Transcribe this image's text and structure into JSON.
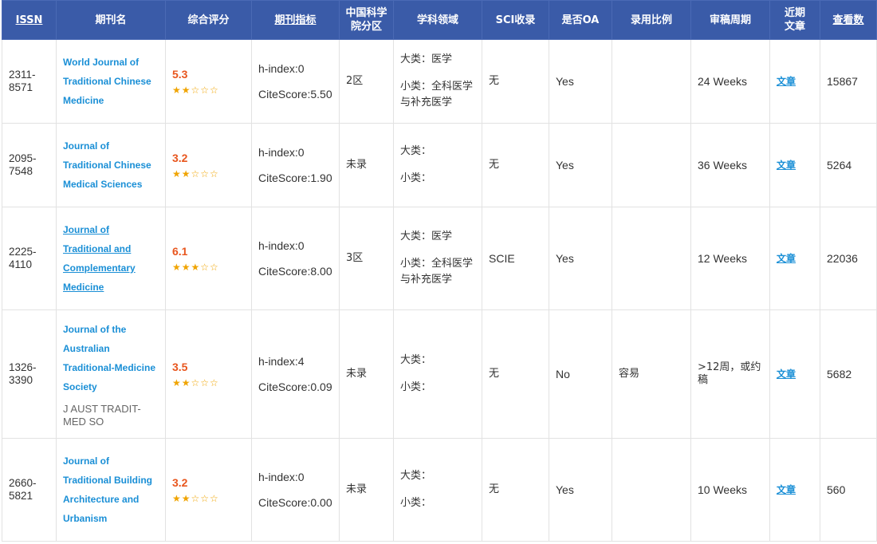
{
  "headers": {
    "issn": "ISSN",
    "name": "期刊名",
    "score": "综合评分",
    "metrics": "期刊指标",
    "cas_line1": "中国科学",
    "cas_line2": "院分区",
    "field": "学科领域",
    "sci": "SCI收录",
    "oa": "是否OA",
    "ratio": "录用比例",
    "review": "审稿周期",
    "recent_line1": "近期",
    "recent_line2": "文章",
    "views": "查看数"
  },
  "rows": [
    {
      "issn_a": "2311-",
      "issn_b": "8571",
      "name_lines": [
        "World Journal of",
        "Traditional Chinese",
        "Medicine"
      ],
      "abbr": "",
      "score": "5.3",
      "stars": "★★☆☆☆",
      "rating_stars": 2.5,
      "hindex": "h-index:0",
      "citescore": "CiteScore:5.50",
      "cas": "2区",
      "major": "大类：医学",
      "minor": "小类：全科医学与补充医学",
      "sci": "无",
      "oa": "Yes",
      "ratio": "",
      "review": "24 Weeks",
      "article": "文章",
      "views": "15867"
    },
    {
      "issn_a": "2095-",
      "issn_b": "7548",
      "name_lines": [
        "Journal of",
        "Traditional Chinese",
        "Medical Sciences"
      ],
      "abbr": "",
      "score": "3.2",
      "stars": "★★☆☆☆",
      "rating_stars": 1.5,
      "hindex": "h-index:0",
      "citescore": "CiteScore:1.90",
      "cas": "未录",
      "major": "大类：",
      "minor": "小类：",
      "sci": "无",
      "oa": "Yes",
      "ratio": "",
      "review": "36 Weeks",
      "article": "文章",
      "views": "5264"
    },
    {
      "issn_a": "2225-",
      "issn_b": "4110",
      "name_lines": [
        "Journal of",
        "Traditional and",
        "Complementary",
        "Medicine"
      ],
      "abbr": "",
      "score": "6.1",
      "stars": "★★★☆☆",
      "rating_stars": 3,
      "hindex": "h-index:0",
      "citescore": "CiteScore:8.00",
      "cas": "3区",
      "major": "大类：医学",
      "minor": "小类：全科医学与补充医学",
      "sci": "SCIE",
      "oa": "Yes",
      "ratio": "",
      "review": "12 Weeks",
      "article": "文章",
      "views": "22036"
    },
    {
      "issn_a": "1326-",
      "issn_b": "3390",
      "name_lines": [
        "Journal of the",
        "Australian",
        "Traditional-Medicine",
        "Society"
      ],
      "abbr": "J AUST TRADIT-MED SO",
      "score": "3.5",
      "stars": "★★☆☆☆",
      "rating_stars": 1.5,
      "hindex": "h-index:4",
      "citescore": "CiteScore:0.09",
      "cas": "未录",
      "major": "大类：",
      "minor": "小类：",
      "sci": "无",
      "oa": "No",
      "ratio": "容易",
      "review": ">12周，或约稿",
      "article": "文章",
      "views": "5682"
    },
    {
      "issn_a": "2660-",
      "issn_b": "5821",
      "name_lines": [
        "Journal of",
        "Traditional Building",
        "Architecture and",
        "Urbanism"
      ],
      "abbr": "",
      "score": "3.2",
      "stars": "★★☆☆☆",
      "rating_stars": 1.5,
      "hindex": "h-index:0",
      "citescore": "CiteScore:0.00",
      "cas": "未录",
      "major": "大类：",
      "minor": "小类：",
      "sci": "无",
      "oa": "Yes",
      "ratio": "",
      "review": "10 Weeks",
      "article": "文章",
      "views": "560"
    }
  ],
  "colors": {
    "header_bg": "#3a5ba8",
    "link": "#1a8fd6",
    "score": "#e8561e",
    "star": "#f0a400"
  }
}
